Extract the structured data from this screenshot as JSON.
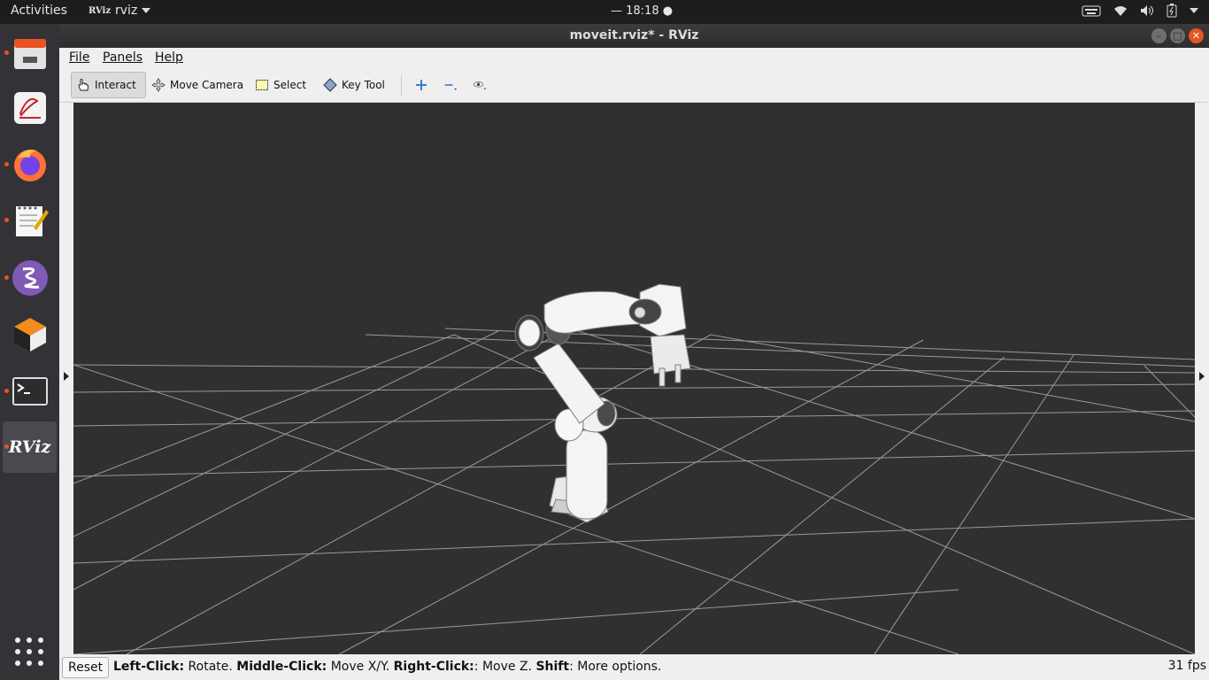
{
  "topbar": {
    "activities": "Activities",
    "app_name": "rviz",
    "app_logo": "RViz",
    "clock": "— 18:18",
    "tray_icons": [
      "keyboard-icon",
      "wifi-icon",
      "volume-icon",
      "battery-icon",
      "power-menu-icon"
    ]
  },
  "dock": {
    "items": [
      "files-icon",
      "document-viewer-icon",
      "firefox-icon",
      "text-editor-icon",
      "emacs-icon",
      "virtualbox-icon",
      "terminal-icon",
      "rviz-icon"
    ],
    "rviz_label": "RViz"
  },
  "window": {
    "title": "moveit.rviz* - RViz",
    "controls": [
      "minimize",
      "maximize",
      "close"
    ]
  },
  "menu": {
    "file": "File",
    "panels": "Panels",
    "help": "Help"
  },
  "toolbar": {
    "interact": "Interact",
    "move_camera": "Move Camera",
    "select": "Select",
    "key_tool": "Key Tool",
    "active_tool": "Interact"
  },
  "status": {
    "reset": "Reset",
    "hint_left_click_key": "Left-Click:",
    "hint_left_click_val": " Rotate. ",
    "hint_middle_click_key": "Middle-Click:",
    "hint_middle_click_val": " Move X/Y. ",
    "hint_right_click_key": "Right-Click:",
    "hint_right_click_val": ": Move Z. ",
    "hint_shift_key": "Shift",
    "hint_shift_val": ": More options.",
    "fps": "31 fps"
  },
  "colors": {
    "accent": "#e95420",
    "viewport_bg": "#303030",
    "grid_line": "#a0a0a0",
    "robot": "#f2f2f2"
  }
}
